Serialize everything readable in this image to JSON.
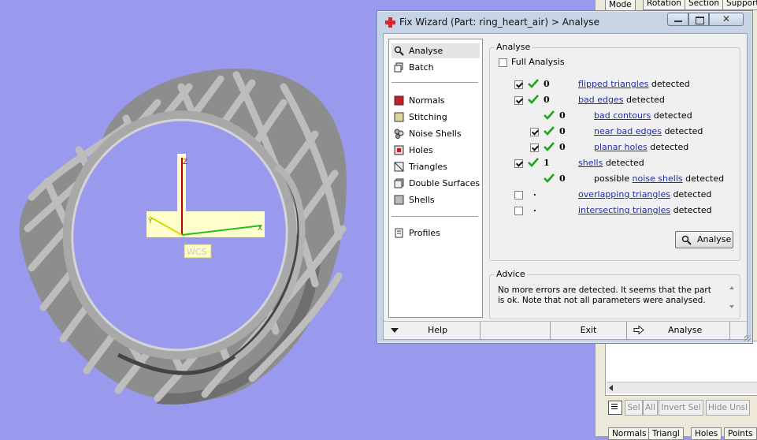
{
  "side_panel": {
    "tabs": [
      "Mode",
      "Rotation",
      "Section",
      "Support"
    ],
    "buttons": [
      "Sel",
      "All",
      "Invert Sel",
      "Hide Unsl"
    ],
    "bottom_tabs": [
      "Normals",
      "Triangl",
      "Holes",
      "Points"
    ]
  },
  "viewport": {
    "axis_label": "WCS",
    "axis_x": "X",
    "axis_y": "Y",
    "axis_z": "Z"
  },
  "dialog": {
    "title": "Fix Wizard (Part: ring_heart_air) > Analyse",
    "nav": {
      "items": [
        {
          "label": "Analyse",
          "icon": "magnifier-icon"
        },
        {
          "label": "Batch",
          "icon": "batch-icon"
        },
        {
          "label": "Normals",
          "icon": "normals-icon"
        },
        {
          "label": "Stitching",
          "icon": "stitching-icon"
        },
        {
          "label": "Noise Shells",
          "icon": "noise-shells-icon"
        },
        {
          "label": "Holes",
          "icon": "holes-icon"
        },
        {
          "label": "Triangles",
          "icon": "triangles-icon"
        },
        {
          "label": "Double Surfaces",
          "icon": "double-surfaces-icon"
        },
        {
          "label": "Shells",
          "icon": "shells-icon"
        },
        {
          "label": "Profiles",
          "icon": "profiles-icon"
        }
      ]
    },
    "analyse": {
      "group_title": "Analyse",
      "full_analysis": "Full Analysis",
      "detected": "detected",
      "rows": [
        {
          "value": "0",
          "link": "flipped triangles"
        },
        {
          "value": "0",
          "link": "bad edges"
        },
        {
          "value": "0",
          "link": "bad contours"
        },
        {
          "value": "0",
          "link": "near bad edges"
        },
        {
          "value": "0",
          "link": "planar holes"
        },
        {
          "value": "1",
          "link": "shells"
        },
        {
          "value": "0",
          "prefix": "possible",
          "link": "noise shells"
        },
        {
          "value": ".",
          "link": "overlapping triangles"
        },
        {
          "value": ".",
          "link": "intersecting triangles"
        }
      ],
      "analyse_button": "Analyse"
    },
    "advice": {
      "title": "Advice",
      "text": "No more errors are detected. It seems that the part is ok. Note that not all parameters were analysed."
    },
    "bottom": {
      "help": "Help",
      "exit": "Exit",
      "analyse": "Analyse"
    }
  },
  "colors": {
    "background": "#9999ee",
    "check_green": "#1aa51a",
    "link": "#1f2fa8"
  }
}
